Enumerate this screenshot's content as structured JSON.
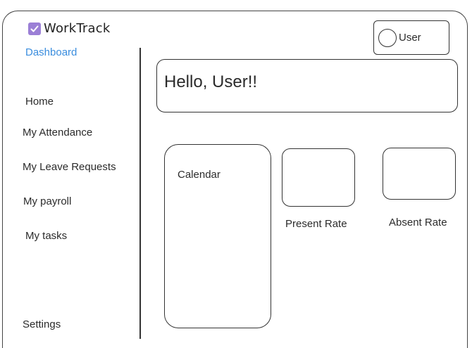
{
  "app": {
    "name": "WorkTrack"
  },
  "sidebar": {
    "active": "Dashboard",
    "items": [
      {
        "label": "Home"
      },
      {
        "label": "My Attendance"
      },
      {
        "label": "My Leave Requests"
      },
      {
        "label": "My payroll"
      },
      {
        "label": "My tasks"
      }
    ],
    "settings": "Settings"
  },
  "header": {
    "user_label": "User"
  },
  "main": {
    "greeting": "Hello, User!!",
    "calendar_label": "Calendar",
    "present_rate_label": "Present Rate",
    "absent_rate_label": "Absent Rate"
  },
  "colors": {
    "accent": "#3a8dde",
    "logo": "#9b7fd6"
  },
  "icons": {
    "logo": "checkbox-icon",
    "user": "avatar-circle-icon"
  }
}
